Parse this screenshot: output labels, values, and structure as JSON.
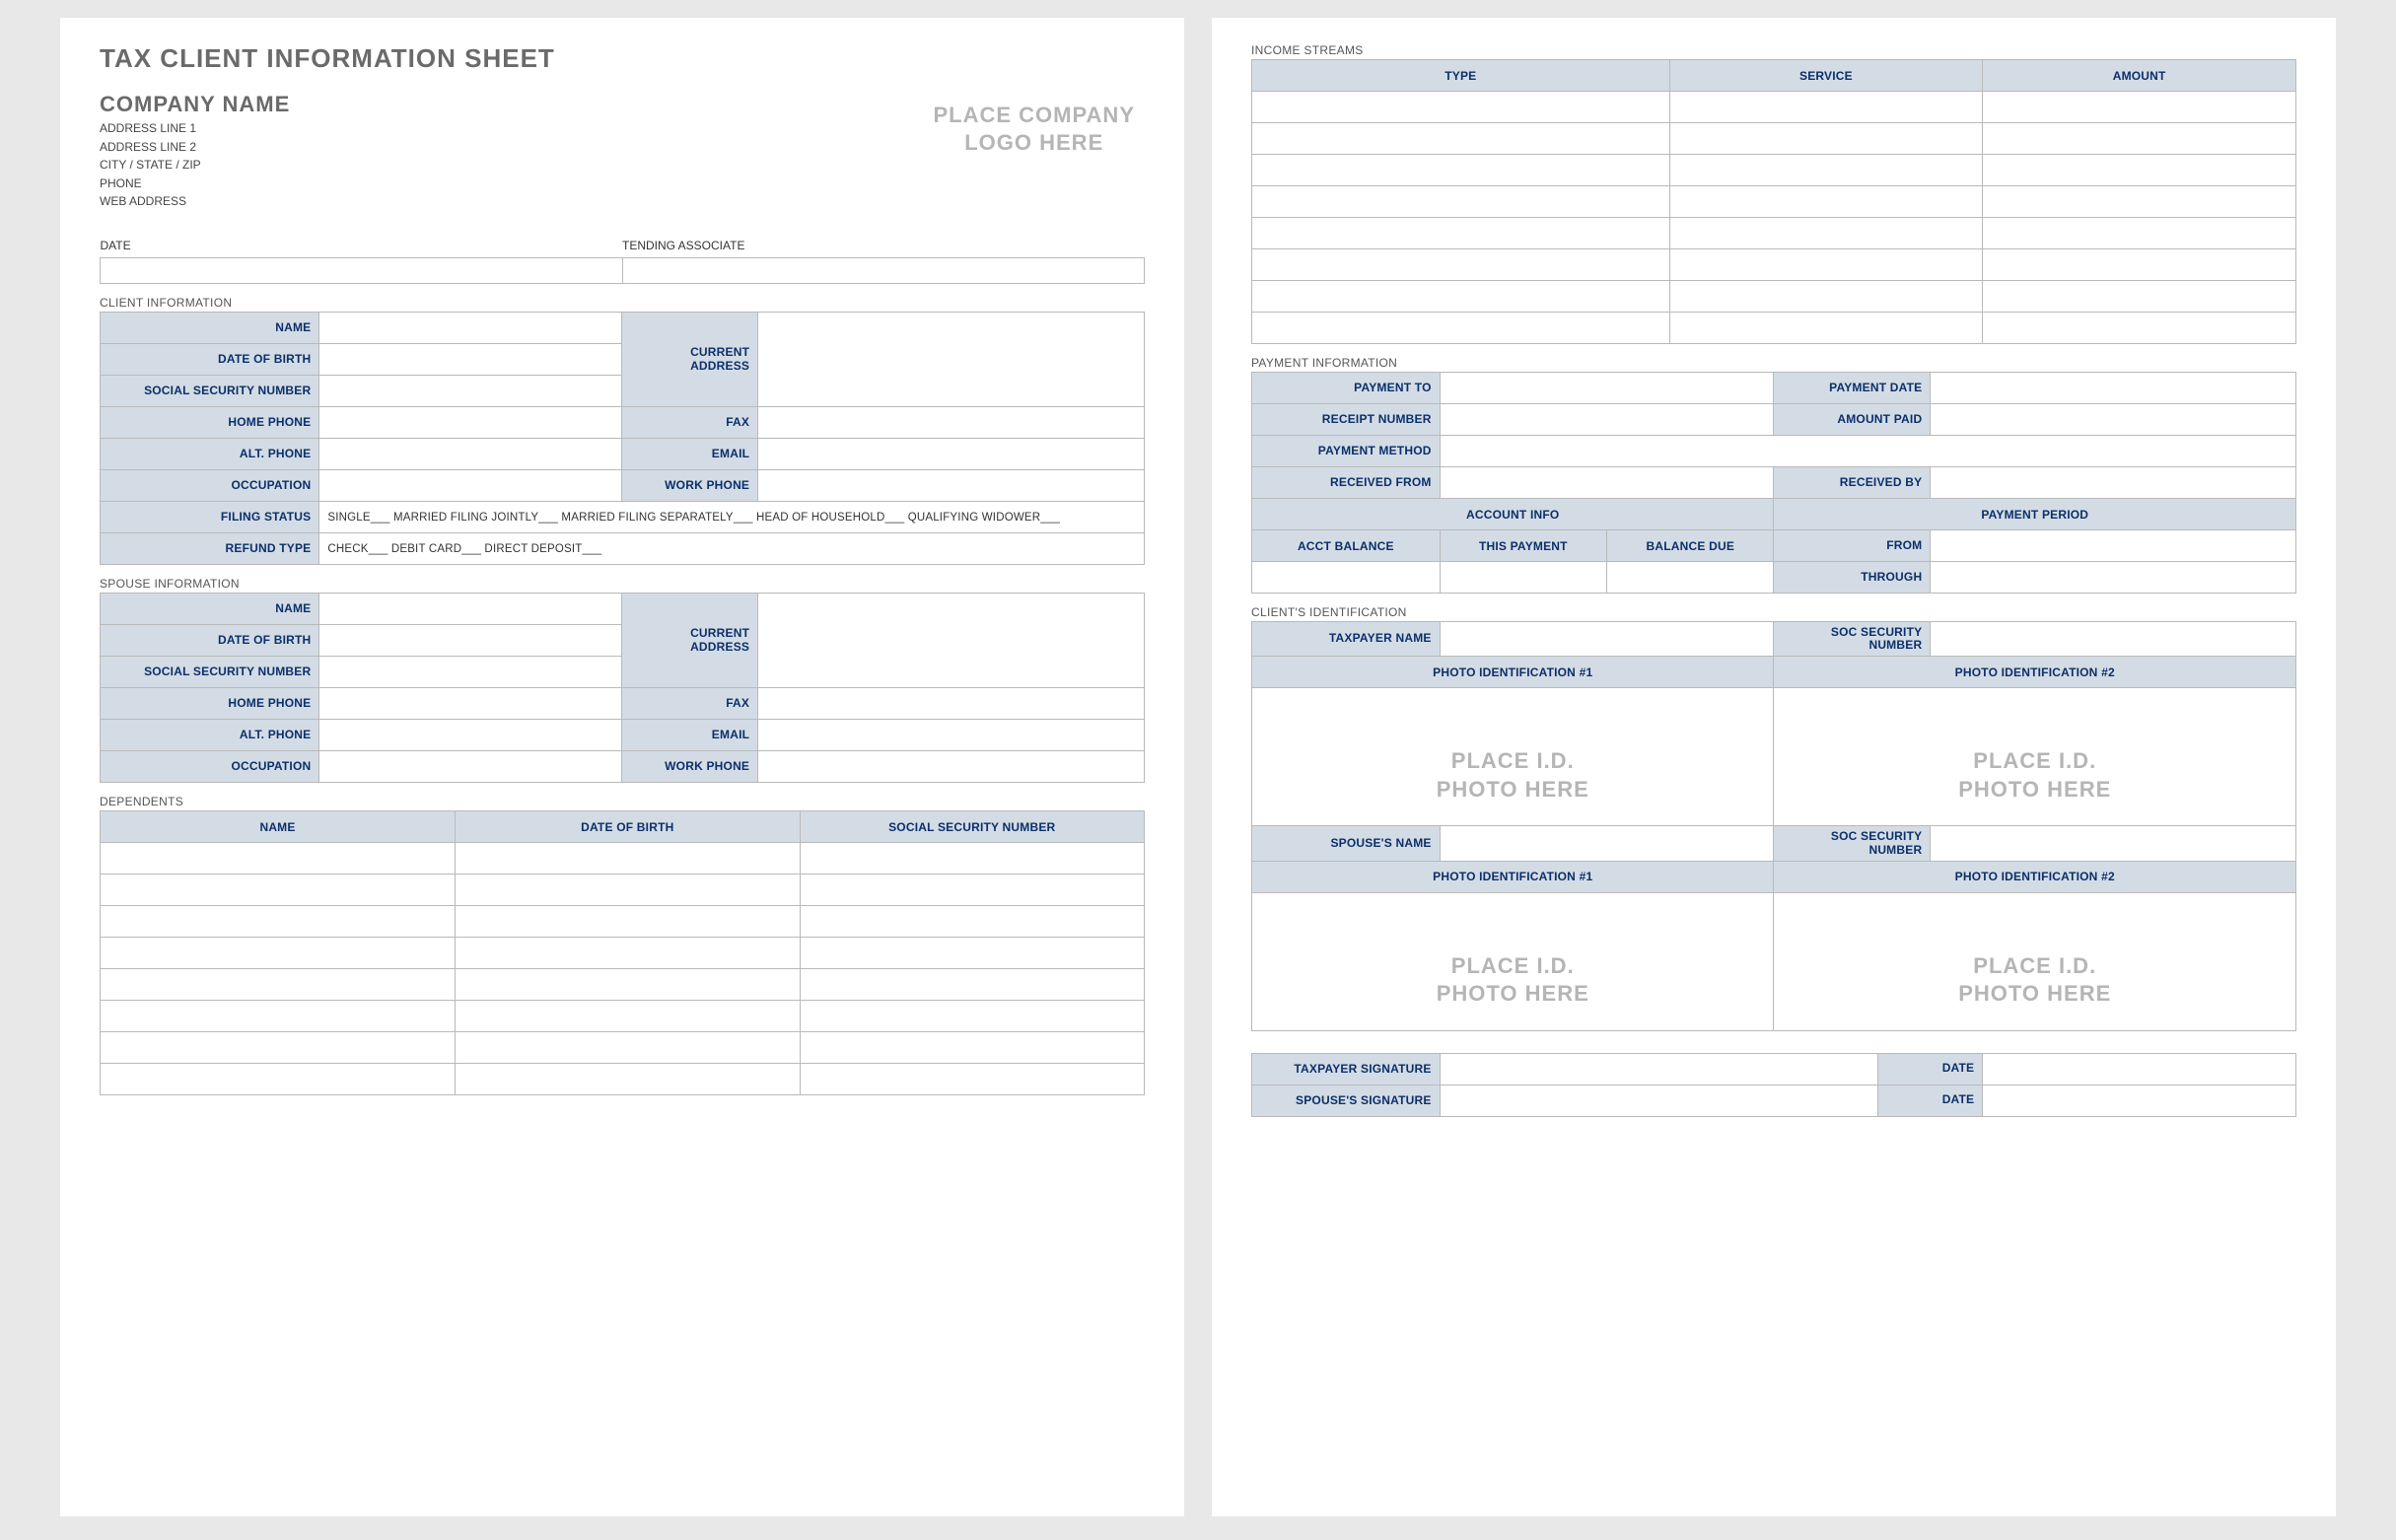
{
  "doc_title": "TAX CLIENT INFORMATION SHEET",
  "company": {
    "name": "COMPANY NAME",
    "addr1": "ADDRESS LINE 1",
    "addr2": "ADDRESS LINE 2",
    "city": "CITY / STATE / ZIP",
    "phone": "PHONE",
    "web": "WEB ADDRESS"
  },
  "logo_placeholder_l1": "PLACE COMPANY",
  "logo_placeholder_l2": "LOGO HERE",
  "top_fields": {
    "date": "DATE",
    "associate": "TENDING ASSOCIATE"
  },
  "sections": {
    "client_info": "CLIENT INFORMATION",
    "spouse_info": "SPOUSE INFORMATION",
    "dependents": "DEPENDENTS",
    "income": "INCOME STREAMS",
    "payment": "PAYMENT INFORMATION",
    "client_id": "CLIENT'S IDENTIFICATION"
  },
  "labels": {
    "name": "NAME",
    "dob": "DATE OF BIRTH",
    "ssn": "SOCIAL SECURITY NUMBER",
    "home_phone": "HOME PHONE",
    "alt_phone": "ALT. PHONE",
    "occupation": "OCCUPATION",
    "filing_status": "FILING STATUS",
    "refund_type": "REFUND TYPE",
    "current_address": "CURRENT ADDRESS",
    "fax": "FAX",
    "email": "EMAIL",
    "work_phone": "WORK PHONE",
    "type": "TYPE",
    "service": "SERVICE",
    "amount": "AMOUNT",
    "payment_to": "PAYMENT TO",
    "payment_date": "PAYMENT DATE",
    "receipt_number": "RECEIPT NUMBER",
    "amount_paid": "AMOUNT PAID",
    "payment_method": "PAYMENT METHOD",
    "received_from": "RECEIVED FROM",
    "received_by": "RECEIVED BY",
    "account_info": "ACCOUNT INFO",
    "payment_period": "PAYMENT PERIOD",
    "acct_balance": "ACCT BALANCE",
    "this_payment": "THIS PAYMENT",
    "balance_due": "BALANCE DUE",
    "from": "FROM",
    "through": "THROUGH",
    "taxpayer_name": "TAXPAYER NAME",
    "soc_sec_num": "SOC SECURITY NUMBER",
    "photo_id_1": "PHOTO IDENTIFICATION #1",
    "photo_id_2": "PHOTO IDENTIFICATION #2",
    "spouse_name": "SPOUSE'S NAME",
    "taxpayer_sig": "TAXPAYER SIGNATURE",
    "spouse_sig": "SPOUSE'S SIGNATURE",
    "sig_date": "DATE"
  },
  "filing_status_text": "SINGLE___   MARRIED FILING JOINTLY___   MARRIED FILING SEPARATELY___  HEAD OF HOUSEHOLD___   QUALIFYING WIDOWER___",
  "refund_type_text": "CHECK___   DEBIT CARD___   DIRECT DEPOSIT___",
  "id_photo_l1": "PLACE I.D.",
  "id_photo_l2": "PHOTO HERE"
}
